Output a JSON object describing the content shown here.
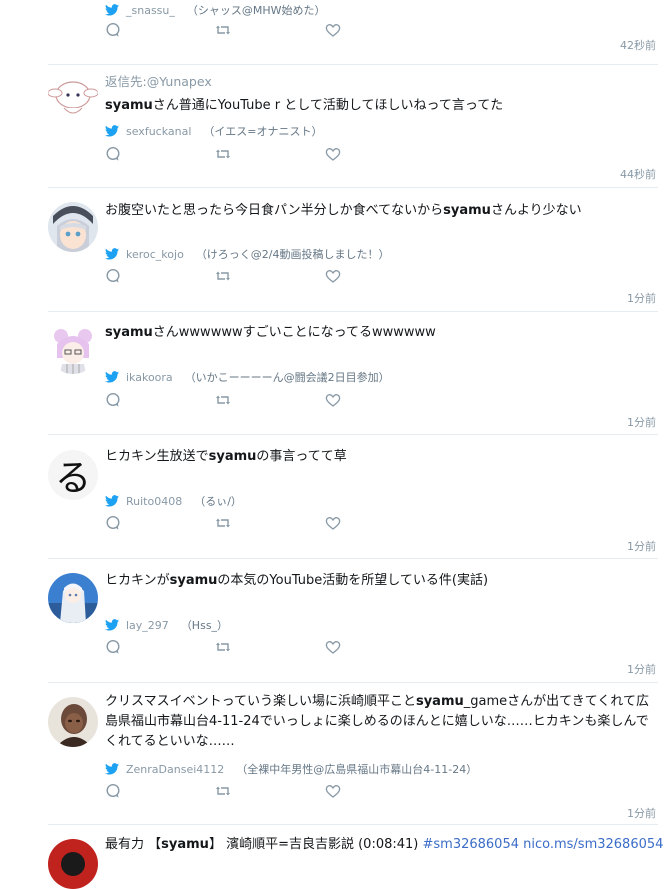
{
  "tweets": [
    {
      "username": "_snassu_",
      "display_name": "（シャッス@MHW始めた）",
      "time": "42秒前"
    },
    {
      "reply_prefix": "返信先:",
      "reply_to": "@Yunapex",
      "text_bold": "syamu",
      "text_rest": "さん普通にYouTube r として活動してほしいねって言ってた",
      "username": "sexfuckanal",
      "display_name": "（イエス=オナニスト）",
      "time": "44秒前"
    },
    {
      "text_prefix": "お腹空いたと思ったら今日食パン半分しか食べてないから",
      "text_bold": "syamu",
      "text_rest": "さんより少ない",
      "username": "keroc_kojo",
      "display_name": "（けろっく@2/4動画投稿しました！）",
      "time": "1分前"
    },
    {
      "text_bold": "syamu",
      "text_rest": "さんwwwwwwすごいことになってるwwwwww",
      "username": "ikakoora",
      "display_name": "（いかこーーーーん@闘会議2日目参加）",
      "time": "1分前"
    },
    {
      "text_prefix": "ヒカキン生放送で",
      "text_bold": "syamu",
      "text_rest": "の事言ってて草",
      "username": "Ruito0408",
      "display_name": "（るぃ/）",
      "time": "1分前"
    },
    {
      "text_prefix": "ヒカキンが",
      "text_bold": "syamu",
      "text_rest": "の本気のYouTube活動を所望している件(実話)",
      "username": "lay_297",
      "display_name": "（Hss_）",
      "time": "1分前"
    },
    {
      "text_prefix": "クリスマスイベントっていう楽しい場に浜崎順平こと",
      "text_bold": "syamu",
      "text_rest": "_gameさんが出てきてくれて広島県福山市幕山台4-11-24でいっしょに楽しめるのほんとに嬉しいな……ヒカキンも楽しんでくれてるといいな……",
      "username": "ZenraDansei4112",
      "display_name": "（全裸中年男性@広島県福山市幕山台4-11-24）",
      "time": "1分前"
    },
    {
      "text_prefix": "最有力 【",
      "text_bold": "syamu",
      "text_rest": "】 濱崎順平=吉良吉影説 (0:08:41) ",
      "text_link": "#sm32686054 nico.ms/sm32686054"
    }
  ],
  "colors": {
    "bird": "#1da1f2",
    "icon_gray": "#8899a6",
    "link": "#3b6dc8",
    "divider": "#e6ecf0"
  },
  "icons": [
    "twitter-bird-icon",
    "reply-icon",
    "retweet-icon",
    "like-icon"
  ]
}
